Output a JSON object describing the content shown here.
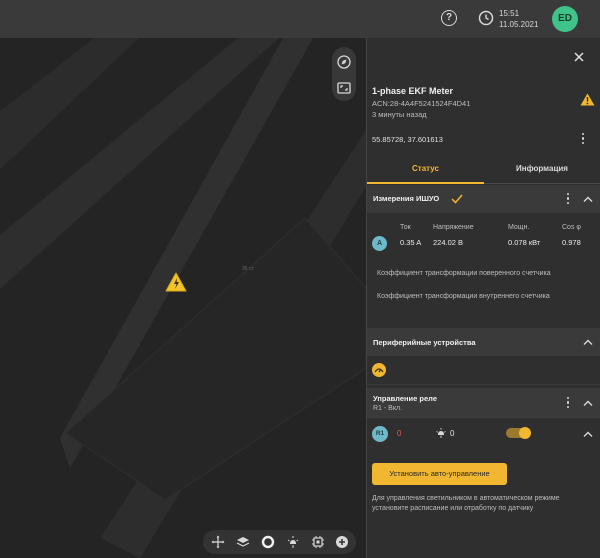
{
  "topbar": {
    "help_glyph": "?",
    "time": "15:51",
    "date": "11.05.2021",
    "avatar_initials": "ED"
  },
  "map": {
    "building_label": "35 ст",
    "tools": [
      "move-icon",
      "layers-icon",
      "circle-icon",
      "lamp-icon",
      "chip-icon",
      "plus-icon"
    ]
  },
  "device": {
    "title": "1-phase EKF Meter",
    "acn": "ACN:28-4A4F5241524F4D41",
    "ago": "3 минуты назад",
    "coords": "55.85728, 37.601613"
  },
  "tabs": {
    "status": "Статус",
    "info": "Информация"
  },
  "measurements": {
    "title": "Измерения ИШУО",
    "phase": "A",
    "headers": [
      "Ток",
      "Напряжение",
      "Мощн.",
      "Cos φ"
    ],
    "values": [
      "0.35 A",
      "224.02 В",
      "0.078 кВт",
      "0.978"
    ],
    "coef_1": "Коэффициент трансформации поверенного счетчика",
    "coef_2": "Коэффициент трансформации внутреннего счетчика"
  },
  "peripherals": {
    "title": "Периферийные устройства"
  },
  "relay": {
    "title": "Управление реле",
    "subtitle": "R1 - Вкл.",
    "badge": "R1",
    "zero_value": "0",
    "count_value": "0",
    "toggle_on": true,
    "auto_button": "Установить авто-управление",
    "note": "Для управления светильником в автоматическом режиме установите расписание или отработку по датчику"
  },
  "colors": {
    "accent": "#f1b731",
    "avatar": "#3fc38a",
    "badge": "#6fb8c9",
    "danger": "#e2574c"
  }
}
